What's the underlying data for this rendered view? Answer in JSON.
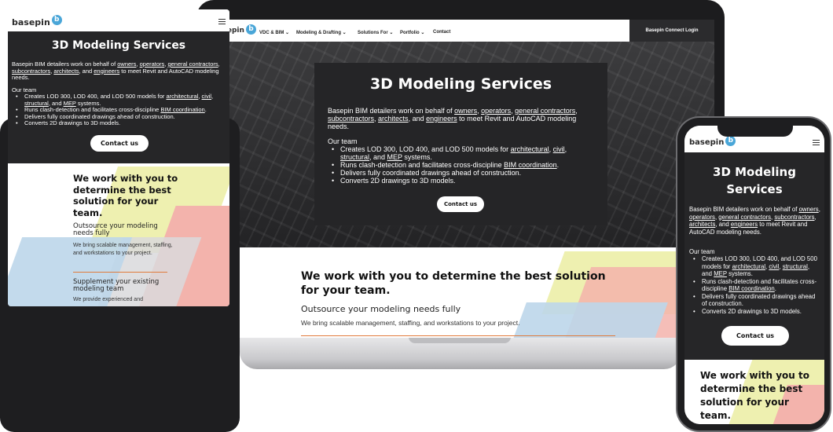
{
  "brand": {
    "logo_text": "basepin",
    "logo_badge": "b"
  },
  "nav": {
    "items": [
      {
        "label": "VDC & BIM",
        "caret": "⌄"
      },
      {
        "label": "Modeling & Drafting",
        "caret": "⌄"
      },
      {
        "label": "Solutions For",
        "caret": "⌄"
      },
      {
        "label": "Portfolio",
        "caret": "⌄"
      },
      {
        "label": "Contact",
        "caret": ""
      }
    ],
    "login": "Basepin Connect Login"
  },
  "hero": {
    "title": "3D Modeling Services",
    "intro": {
      "before": "Basepin BIM detailers work on behalf of ",
      "links": [
        "owners",
        "operators",
        "general contractors",
        "subcontractors",
        "architects",
        "engineers"
      ],
      "sep1": ", ",
      "and": ", and ",
      "after": " to meet Revit and AutoCAD modeling needs."
    },
    "team_label": "Our team",
    "bullets": {
      "b1_before": "Creates LOD 300, LOD 400, and LOD 500 models for ",
      "b1_link1": "architectural",
      "b1_link2": "civil",
      "b1_link3": "structural",
      "b1_and": ", and ",
      "b1_link4": "MEP",
      "b1_after": " systems.",
      "b2_before": "Runs clash-detection and facilitates cross-discipline ",
      "b2_link": "BIM coordination",
      "b2_after": ".",
      "b3": "Delivers fully coordinated drawings ahead of construction.",
      "b4": "Converts 2D drawings to 3D models."
    },
    "cta": "Contact us"
  },
  "section": {
    "title": "We work with you to determine the best solution for your team.",
    "item1_title": "Outsource your modeling needs fully",
    "item1_text": "We bring scalable management, staffing, and workstations to your project.",
    "item2_title": "Supplement your existing modeling team",
    "item2_text": "We provide experienced and"
  },
  "colors": {
    "dark": "#252527",
    "yellow": "#eef0b0",
    "pink": "#f3b3ac",
    "blue": "#bcd6ea",
    "grey": "#d9d9dc",
    "accent_rule": "#e07a3a",
    "logo_badge": "#4aa6d8"
  }
}
